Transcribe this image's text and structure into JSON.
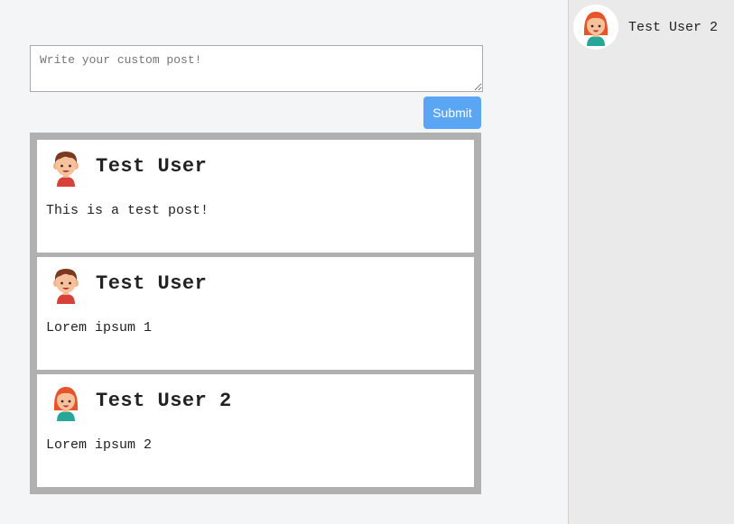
{
  "composer": {
    "placeholder": "Write your custom post!",
    "value": "",
    "submit_label": "Submit"
  },
  "posts": [
    {
      "author": "Test User",
      "avatar": "boy-avatar-icon",
      "body": "This is a test post!"
    },
    {
      "author": "Test User",
      "avatar": "boy-avatar-icon",
      "body": "Lorem ipsum 1"
    },
    {
      "author": "Test User 2",
      "avatar": "girl-avatar-icon",
      "body": "Lorem ipsum 2"
    }
  ],
  "sidebar": {
    "users": [
      {
        "name": "Test User 2",
        "avatar": "girl-avatar-icon"
      }
    ]
  },
  "colors": {
    "submit_button": "#5aa6f5",
    "feed_border": "#b0b0b0",
    "sidebar_background": "#eaeaea",
    "page_background": "#f4f5f7"
  }
}
